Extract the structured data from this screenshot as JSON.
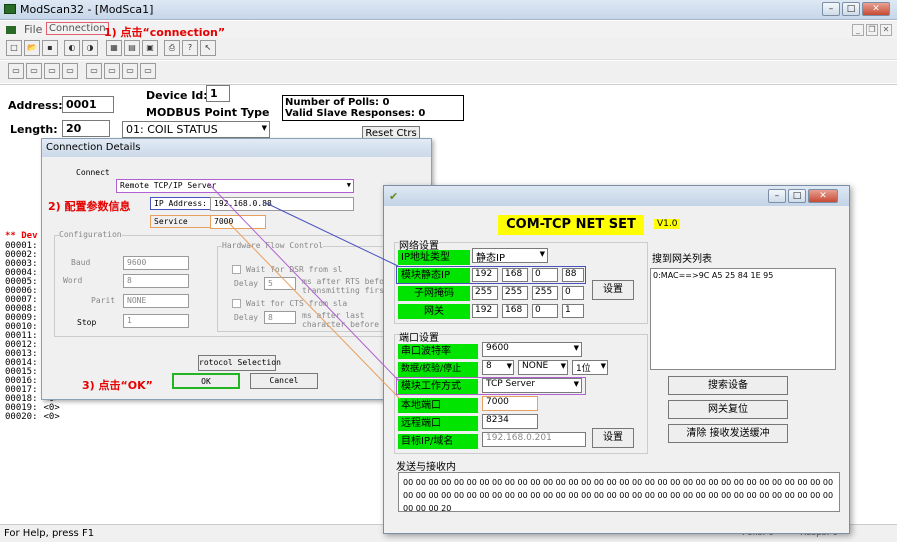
{
  "app": {
    "title": "ModScan32 - [ModSca1]",
    "menu": {
      "file": "File",
      "connection": "Connection"
    },
    "help_status": "For Help, press F1",
    "polls_label": "Polls:",
    "polls_value": "0",
    "resps_label": "Resps:",
    "resps_value": "0"
  },
  "annotations": {
    "step1": "1) 点击“connection”",
    "step2": "2) 配置参数信息",
    "step3": "3) 点击“OK”"
  },
  "modscan": {
    "device_id_label": "Device Id:",
    "device_id": "1",
    "point_type_label": "MODBUS Point Type",
    "address_label": "Address:",
    "address": "0001",
    "length_label": "Length:",
    "length": "20",
    "point_type": "01: COIL STATUS",
    "num_polls": "Number of Polls: 0",
    "valid_responses": "Valid Slave Responses: 0",
    "reset_ctrs": "Reset Ctrs",
    "dev_banner": "** Dev",
    "registers": [
      "00001:",
      "00002:",
      "00003:",
      "00004:",
      "00005:",
      "00006:",
      "00007:",
      "00008:",
      "00009:",
      "00010:",
      "00011:",
      "00012:",
      "00013:",
      "00014:",
      "00015:",
      "00016:",
      "00017:",
      "00018:",
      "00019:",
      "00020:"
    ],
    "register_value": "<0>"
  },
  "conn_dialog": {
    "title": "Connection Details",
    "connect_label": "Connect",
    "connect_value": "Remote TCP/IP Server",
    "ip_label": "IP Address:",
    "ip_value": "192.168.0.88",
    "service_label": "Service",
    "service_value": "7000",
    "configuration_label": "Configuration",
    "baud_label": "Baud",
    "baud_value": "9600",
    "word_label": "Word",
    "word_value": "8",
    "parity_label": "Parit",
    "parity_value": "NONE",
    "stop_label": "Stop",
    "stop_value": "1",
    "hw_flow_label": "Hardware Flow Control",
    "wait_dsr": "Wait for DSR from sl",
    "delay1_label": "Delay",
    "delay1_value": "5",
    "delay1_note": "ms after RTS before transmitting first",
    "wait_cts": "Wait for CTS from sla",
    "delay2_label": "Delay",
    "delay2_value": "8",
    "delay2_note": "ms after last character before",
    "protocol_btn": "rotocol Selection",
    "ok": "OK",
    "cancel": "Cancel"
  },
  "com_tcp": {
    "title": "COM-TCP NET SET",
    "version": "V1.0",
    "network_settings": "网络设置",
    "ip_type_label": "IP地址类型",
    "ip_type_value": "静态IP",
    "static_ip_label": "模块静态IP",
    "ip": [
      "192",
      "168",
      "0",
      "88"
    ],
    "subnet_label": "子网掩码",
    "subnet": [
      "255",
      "255",
      "255",
      "0"
    ],
    "gateway_label": "网关",
    "gateway": [
      "192",
      "168",
      "0",
      "1"
    ],
    "set_button": "设置",
    "port_settings": "端口设置",
    "baud_label": "串口波特率",
    "baud_value": "9600",
    "data_check_label": "数据/校验/停止",
    "data_bits": "8",
    "parity": "NONE",
    "stop_bits": "1位",
    "mode_label": "模块工作方式",
    "mode_value": "TCP Server",
    "local_port_label": "本地端口",
    "local_port": "7000",
    "remote_port_label": "远程端口",
    "remote_port": "8234",
    "target_label": "目标IP/域名",
    "target_value": "192.168.0.201",
    "set_button2": "设置",
    "found_list_label": "搜到网关列表",
    "found_item": "0:MAC==>9C A5 25 84 1E 95",
    "search_btn": "搜索设备",
    "reset_btn": "网关复位",
    "clear_btn": "清除 接收发送缓冲",
    "send_recv_label": "发送与接收内",
    "send_recv_content": "00 00 00 00 00 00 00 00 00 00 00 00 00 00 00 00 00 00 00 00 00 00 00 00 00 00 00 00 00 00 00 00 00 00 00 00 00 00 00 00 00 00 00 00 00 00 00 00 00 00 00 00 00 00 00 00 00 00 00 00 00 00 00 00 00 00 00 00 00 00 00 20"
  },
  "colors": {
    "annotation": "#e60000",
    "green_label": "#00e400",
    "title_yellow": "#ffff00",
    "highlight_purple": "#a040d0",
    "highlight_blue": "#4a50c0",
    "highlight_orange": "#e8a060"
  }
}
